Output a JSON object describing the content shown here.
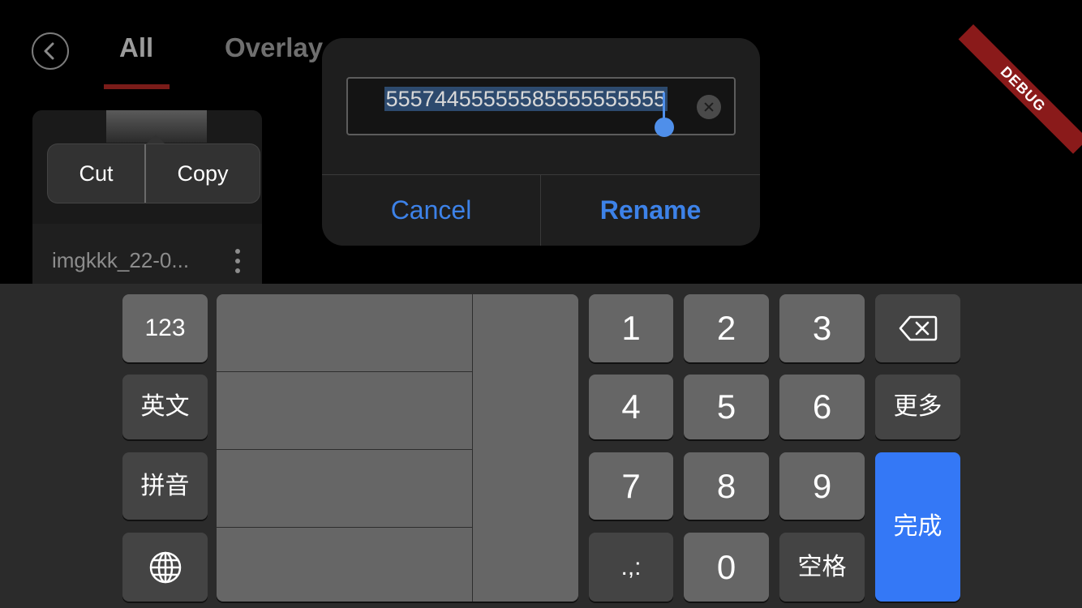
{
  "nav": {
    "tabs": [
      {
        "label": "All"
      },
      {
        "label": "Overlay"
      }
    ]
  },
  "card": {
    "name": "imgkkk_22-0..."
  },
  "context_menu": {
    "cut_label": "Cut",
    "copy_label": "Copy"
  },
  "rename_dialog": {
    "input_value": "55574455555585555555555",
    "cancel_label": "Cancel",
    "rename_label": "Rename"
  },
  "debug_banner": "DEBUG",
  "keyboard": {
    "left_keys": [
      "123",
      "英文",
      "拼音"
    ],
    "globe_icon": "globe-icon",
    "digits": [
      "1",
      "2",
      "3",
      "4",
      "5",
      "6",
      "7",
      "8",
      "9",
      "0"
    ],
    "punct_label": ".,:",
    "space_label": "空格",
    "more_label": "更多",
    "done_label": "完成",
    "delete_icon": "backspace-icon"
  },
  "colors": {
    "accent": "#3478f6",
    "link": "#3d82e8",
    "tab_underline": "#7a1c19",
    "debug": "#8a1a1a"
  }
}
